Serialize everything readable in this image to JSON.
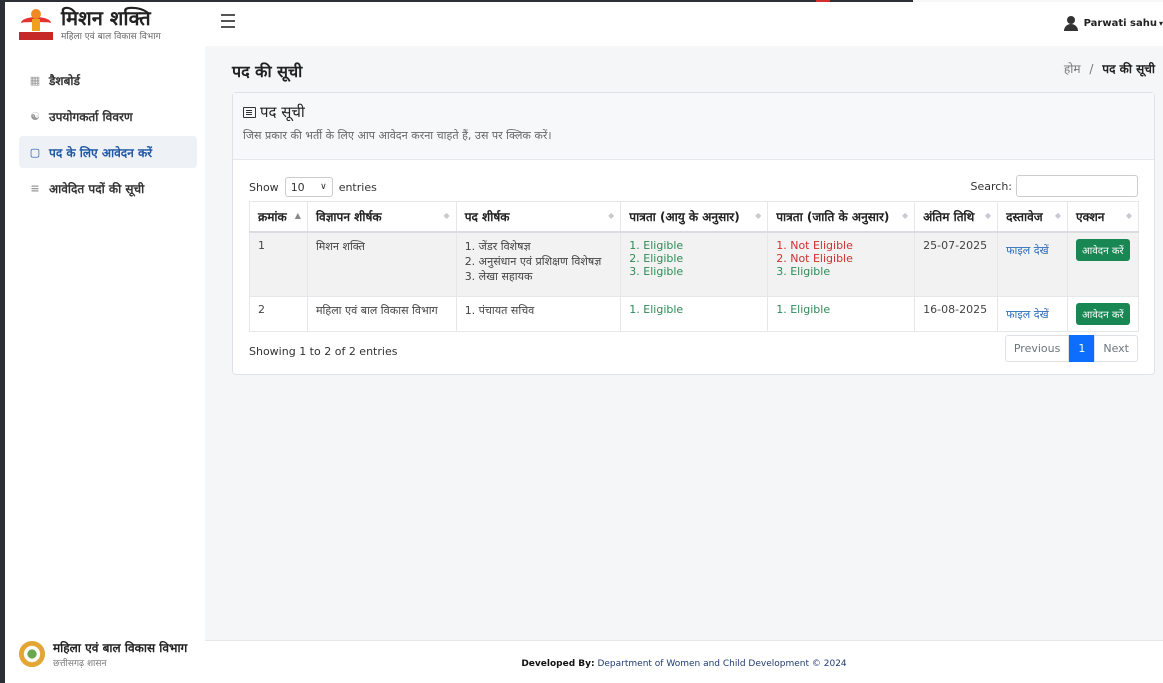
{
  "brand": {
    "title": "मिशन शक्ति",
    "subtitle": "महिला एवं बाल विकास विभाग"
  },
  "sidebar": {
    "items": [
      {
        "label": "डैशबोर्ड",
        "icon": "grid-icon"
      },
      {
        "label": "उपयोगकर्ता विवरण",
        "icon": "user-icon"
      },
      {
        "label": "पद के लिए आवेदन करें",
        "icon": "document-icon"
      },
      {
        "label": "आवेदित पदों की सूची",
        "icon": "list-icon"
      }
    ],
    "footer_title": "महिला एवं बाल विकास विभाग",
    "footer_subtitle": "छत्तीसगढ़ शासन"
  },
  "topbar": {
    "user_name": "Parwati sahu"
  },
  "page": {
    "title": "पद की सूची",
    "breadcrumb": {
      "home": "होम",
      "separator": "/",
      "current": "पद की सूची"
    }
  },
  "card": {
    "title": "पद सूची",
    "subtitle": "जिस प्रकार की भर्ती के लिए आप आवेदन करना चाहते हैं, उस पर क्लिक करें।"
  },
  "table_controls": {
    "show_label": "Show",
    "entries_value": "10",
    "entries_label": "entries",
    "search_label": "Search:"
  },
  "table": {
    "headers": [
      "क्रमांक",
      "विज्ञापन शीर्षक",
      "पद शीर्षक",
      "पात्रता (आयु के अनुसार)",
      "पात्रता (जाति के अनुसार)",
      "अंतिम तिथि",
      "दस्तावेज",
      "एक्शन"
    ],
    "rows": [
      {
        "serial": "1",
        "advertisement": "मिशन शक्ति",
        "posts": [
          "1. जेंडर विशेषज्ञ",
          "2. अनुसंधान एवं प्रशिक्षण विशेषज्ञ",
          "3. लेखा सहायक"
        ],
        "eligibility_age": [
          "1. Eligible",
          "2. Eligible",
          "3. Eligible"
        ],
        "eligibility_caste": [
          "1. Not Eligible",
          "2. Not Eligible",
          "3. Eligible"
        ],
        "last_date": "25-07-2025",
        "document": "फाइल देखें",
        "action": "आवेदन करें"
      },
      {
        "serial": "2",
        "advertisement": "महिला एवं बाल विकास विभाग",
        "posts": [
          "1. पंचायत सचिव"
        ],
        "eligibility_age": [
          "1. Eligible"
        ],
        "eligibility_caste": [
          "1. Eligible"
        ],
        "last_date": "16-08-2025",
        "document": "फाइल देखें",
        "action": "आवेदन करें"
      }
    ]
  },
  "pagination": {
    "info": "Showing 1 to 2 of 2 entries",
    "previous": "Previous",
    "current": "1",
    "next": "Next"
  },
  "footer": {
    "developed_by_label": "Developed By:",
    "developed_by_text": "Department of Women and Child Development © 2024"
  },
  "colors": {
    "eligible": "#2e8b57",
    "not_eligible": "#d03030",
    "primary": "#0d6efd",
    "success": "#198754"
  }
}
